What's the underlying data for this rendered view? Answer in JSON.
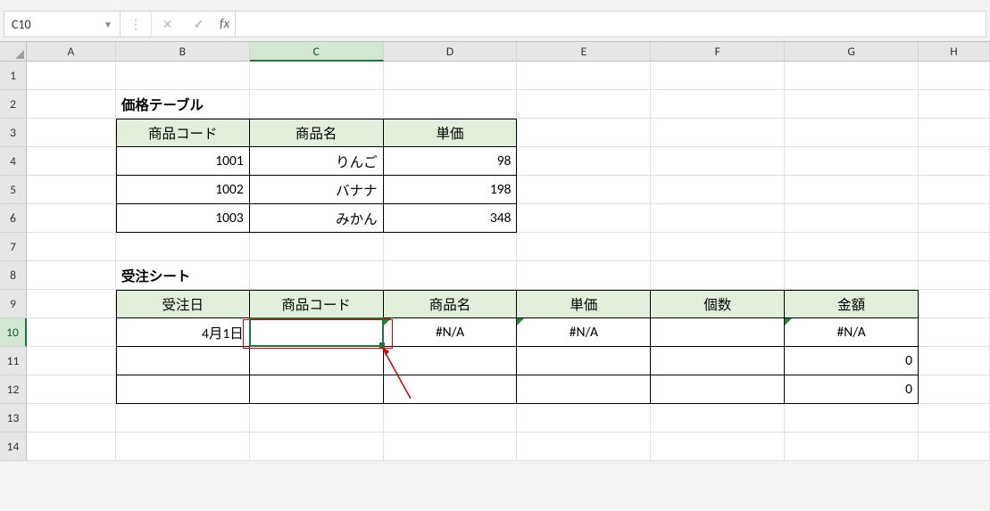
{
  "name_box": "C10",
  "formula_value": "",
  "col_headers": [
    "A",
    "B",
    "C",
    "D",
    "E",
    "F",
    "G",
    "H"
  ],
  "active_col": "C",
  "active_row": "10",
  "row_nums": [
    "1",
    "2",
    "3",
    "4",
    "5",
    "6",
    "7",
    "8",
    "9",
    "10",
    "11",
    "12",
    "13",
    "14"
  ],
  "price_table": {
    "title": "価格テーブル",
    "headers": [
      "商品コード",
      "商品名",
      "単価"
    ],
    "rows": [
      {
        "code": "1001",
        "name": "りんご",
        "price": "98"
      },
      {
        "code": "1002",
        "name": "バナナ",
        "price": "198"
      },
      {
        "code": "1003",
        "name": "みかん",
        "price": "348"
      }
    ]
  },
  "order_sheet": {
    "title": "受注シート",
    "headers": [
      "受注日",
      "商品コード",
      "商品名",
      "単価",
      "個数",
      "金額"
    ],
    "rows": [
      {
        "date": "4月1日",
        "code": "",
        "name": "#N/A",
        "unit": "#N/A",
        "qty": "",
        "amount": "#N/A"
      },
      {
        "date": "",
        "code": "",
        "name": "",
        "unit": "",
        "qty": "",
        "amount": "0"
      },
      {
        "date": "",
        "code": "",
        "name": "",
        "unit": "",
        "qty": "",
        "amount": "0"
      }
    ]
  },
  "fx_label": "fx"
}
